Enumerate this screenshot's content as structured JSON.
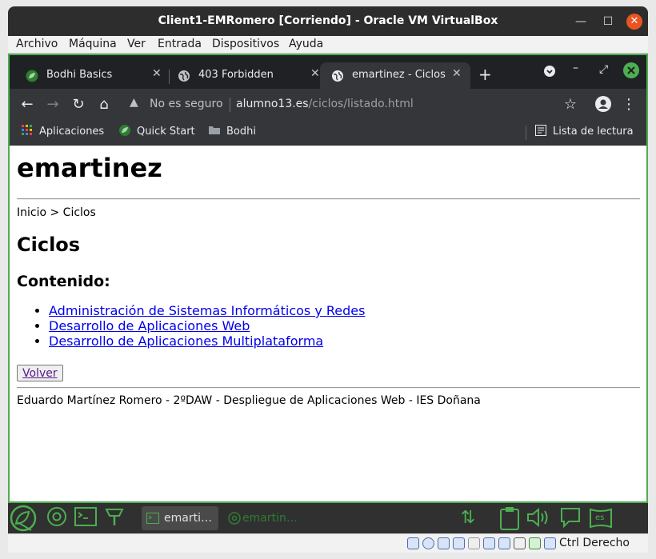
{
  "vbox": {
    "title": "Client1-EMRomero [Corriendo] - Oracle VM VirtualBox",
    "menu": [
      "Archivo",
      "Máquina",
      "Ver",
      "Entrada",
      "Dispositivos",
      "Ayuda"
    ],
    "host_key": "Ctrl Derecho"
  },
  "browser": {
    "tabs": [
      {
        "label": "Bodhi Basics",
        "active": false
      },
      {
        "label": "403 Forbidden",
        "active": false
      },
      {
        "label": "emartinez - Ciclos",
        "active": true
      }
    ],
    "omnibox": {
      "security": "No es seguro",
      "host": "alumno13.es",
      "path": "/ciclos/listado.html"
    },
    "bookmarks": [
      "Aplicaciones",
      "Quick Start",
      "Bodhi"
    ],
    "reading_list": "Lista de lectura"
  },
  "page": {
    "site_title": "emartinez",
    "breadcrumb": "Inicio > Ciclos",
    "heading": "Ciclos",
    "subheading": "Contenido:",
    "links": [
      "Administración de Sistemas Informáticos y Redes",
      "Desarrollo de Aplicaciones Web",
      "Desarrollo de Aplicaciones Multiplataforma"
    ],
    "back_button": "Volver",
    "footer": "Eduardo Martínez Romero - 2ºDAW - Despliegue de Aplicaciones Web - IES Doñana"
  },
  "taskbar": {
    "tasks": [
      "emarti…",
      "emartin…"
    ],
    "keyboard_layout": "es"
  },
  "colors": {
    "accent": "#4caf50",
    "link": "#0000ee",
    "visited": "#551a8b",
    "close_button": "#e95420"
  }
}
